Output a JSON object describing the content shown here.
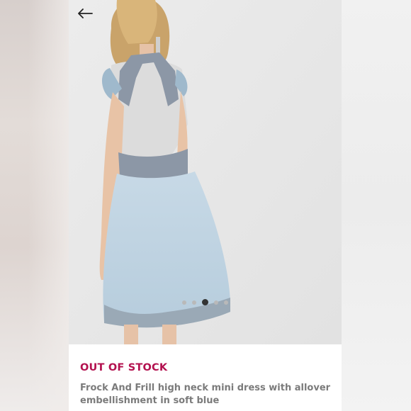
{
  "colors": {
    "status": "#b3114f",
    "title_text": "#7b7b7b",
    "photo_background": "#e6e6e6"
  },
  "icons": {
    "back": "arrow-left-icon"
  },
  "carousel": {
    "total": 5,
    "active_index": 2
  },
  "product": {
    "status": "OUT OF STOCK",
    "title": "Frock And Frill high neck mini dress with allover embellishment in soft blue"
  }
}
